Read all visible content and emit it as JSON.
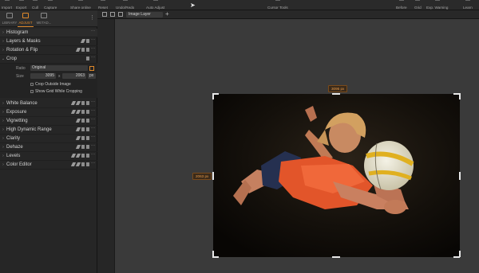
{
  "toolbar": {
    "items": [
      "Import",
      "Export",
      "Cull",
      "Capture",
      "Share online",
      "Reset",
      "Undo/Redo",
      "Auto Adjust",
      "Cursor Tools",
      "Before",
      "Grid",
      "Exp. Warning",
      "Learn"
    ]
  },
  "panel": {
    "tabs": [
      "LIBRARY",
      "ADJUST",
      "METAD..."
    ],
    "active_tab": "ADJUST",
    "sections": [
      "Histogram",
      "Layers & Masks",
      "Rotation & Flip",
      "Crop",
      "White Balance",
      "Exposure",
      "Vignetting",
      "High Dynamic Range",
      "Clarity",
      "Dehaze",
      "Levels",
      "Color Editor"
    ],
    "crop": {
      "ratio_label": "Ratio",
      "ratio_value": "Original",
      "size_label": "Size",
      "width": "3095",
      "times": "x",
      "height": "2063",
      "unit": "px",
      "crop_outside_image": "Crop Outside Image",
      "show_grid": "Show Grid While Cropping"
    }
  },
  "viewer": {
    "layer": "Image Layer",
    "width_tag": "3095 px",
    "height_tag": "2063 px"
  },
  "colors": {
    "accent": "#e0892a",
    "background": "#3a3a3a",
    "panel": "#262626"
  }
}
